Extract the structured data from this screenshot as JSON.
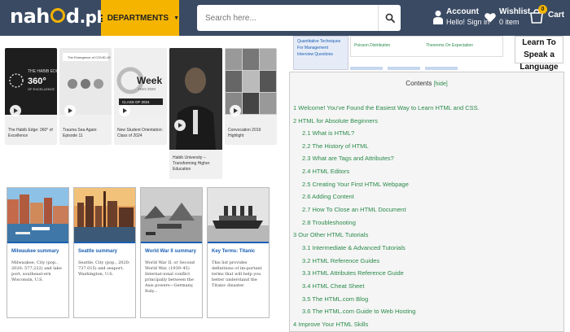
{
  "header": {
    "logo_pre": "nah",
    "logo_post": "d",
    "logo_tld": ".pk",
    "departments_label": "DEPARTMENTS",
    "search_placeholder": "Search here...",
    "account_title": "Account",
    "account_sub": "Hello! Sign in",
    "wishlist_title": "Wishlist",
    "wishlist_sub": "0 item",
    "cart_label": "Cart",
    "cart_count": "0"
  },
  "videos": [
    {
      "caption": "The Habib Edge: 360° of Excellence",
      "thumb_text": "THE HABIB EDGE 360° OF EXCELLENCE"
    },
    {
      "caption": "Trauma Sea Again: Episode 11",
      "thumb_text": "The Emergence of COVID-19: The Changes you Will Face"
    },
    {
      "caption": "New Student Orientation: Class of 2024",
      "thumb_text": "Week HSO 2020 CLASS OF 2024"
    },
    {
      "caption": "Habib University – Transforming Higher Education",
      "thumb_text": ""
    },
    {
      "caption": "Convocation 2019 Highlight",
      "thumb_text": ""
    }
  ],
  "summaries": [
    {
      "title": "Milwaukee summary",
      "text": "Milwaukee, City (pop., 2020: 577,222) and lake port, southeast-ern Wisconsin, U.S."
    },
    {
      "title": "Seattle summary",
      "text": "Seattle, City (pop., 2020: 737,015) and seaport, Washington, U.S."
    },
    {
      "title": "World War II summary",
      "text": "World War II, or Second World War, (1939–45) Internat-ional conflict principally between the Axis powers—Germany, Italy..."
    },
    {
      "title": "Key Terms: Titanic",
      "text": "This list provides definitions of im-portant terms that will help you better understand the Titanic disaster."
    }
  ],
  "mini": {
    "ad_text": "Quantitative Techniques For Management Interview Questions",
    "link1": "Poisson Distribution",
    "link2": "Theorems On Expectation",
    "ad_box": "Learn To Speak a Language"
  },
  "contents": {
    "title": "Contents",
    "hide": "[hide]",
    "items": [
      {
        "num": "1",
        "text": "Welcome! You've Found the Easiest Way to Learn HTML and CSS."
      },
      {
        "num": "2",
        "text": "HTML for Absolute Beginners"
      },
      {
        "num": "2.1",
        "text": "What is HTML?"
      },
      {
        "num": "2.2",
        "text": "The History of HTML"
      },
      {
        "num": "2.3",
        "text": "What are Tags and Attributes?"
      },
      {
        "num": "2.4",
        "text": "HTML Editors"
      },
      {
        "num": "2.5",
        "text": "Creating Your First HTML Webpage"
      },
      {
        "num": "2.6",
        "text": "Adding Content"
      },
      {
        "num": "2.7",
        "text": "How To Close an HTML Document"
      },
      {
        "num": "2.8",
        "text": "Troubleshooting"
      },
      {
        "num": "3",
        "text": "Our Other HTML Tutorials"
      },
      {
        "num": "3.1",
        "text": "Intermediate & Advanced Tutorials"
      },
      {
        "num": "3.2",
        "text": "HTML Reference Guides"
      },
      {
        "num": "3.3",
        "text": "HTML Attributes Reference Guide"
      },
      {
        "num": "3.4",
        "text": "HTML Cheat Sheet"
      },
      {
        "num": "3.5",
        "text": "The HTML.com Blog"
      },
      {
        "num": "3.6",
        "text": "The HTML.com Guide to Web Hosting"
      },
      {
        "num": "4",
        "text": "Improve Your HTML Skills"
      }
    ]
  },
  "colors": {
    "header_bg": "#3a4a63",
    "accent": "#f4b400",
    "link_green": "#2a8a4a",
    "summary_blue": "#1a5fb4"
  }
}
